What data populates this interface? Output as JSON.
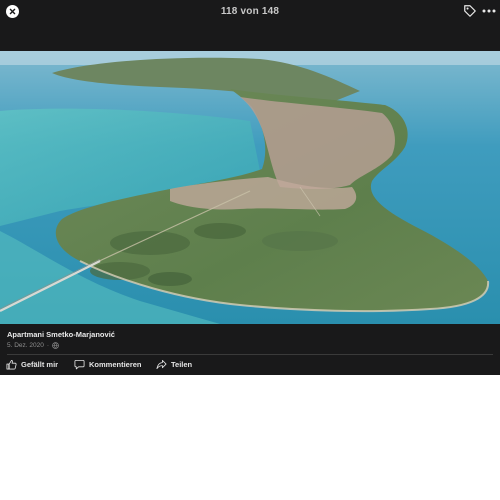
{
  "header": {
    "counter": "118 von 148"
  },
  "icons": {
    "close": "close-icon",
    "tag": "tag-icon",
    "more": "more-horizontal-icon",
    "like": "thumbs-up-icon",
    "comment": "speech-bubble-icon",
    "share": "share-arrow-icon",
    "audience": "globe-icon"
  },
  "photo": {
    "subject": "aerial view of a green peninsula with a town, surrounded by turquoise sea and a long bridge"
  },
  "post": {
    "author": "Apartmani Smetko-Marjanović",
    "date": "5. Dez. 2020",
    "separator": "·"
  },
  "actions": {
    "like_label": "Gefällt mir",
    "comment_label": "Kommentieren",
    "share_label": "Teilen"
  },
  "colors": {
    "background": "#19191a",
    "text": "#e4e4e4",
    "muted": "#8f8f8f"
  }
}
